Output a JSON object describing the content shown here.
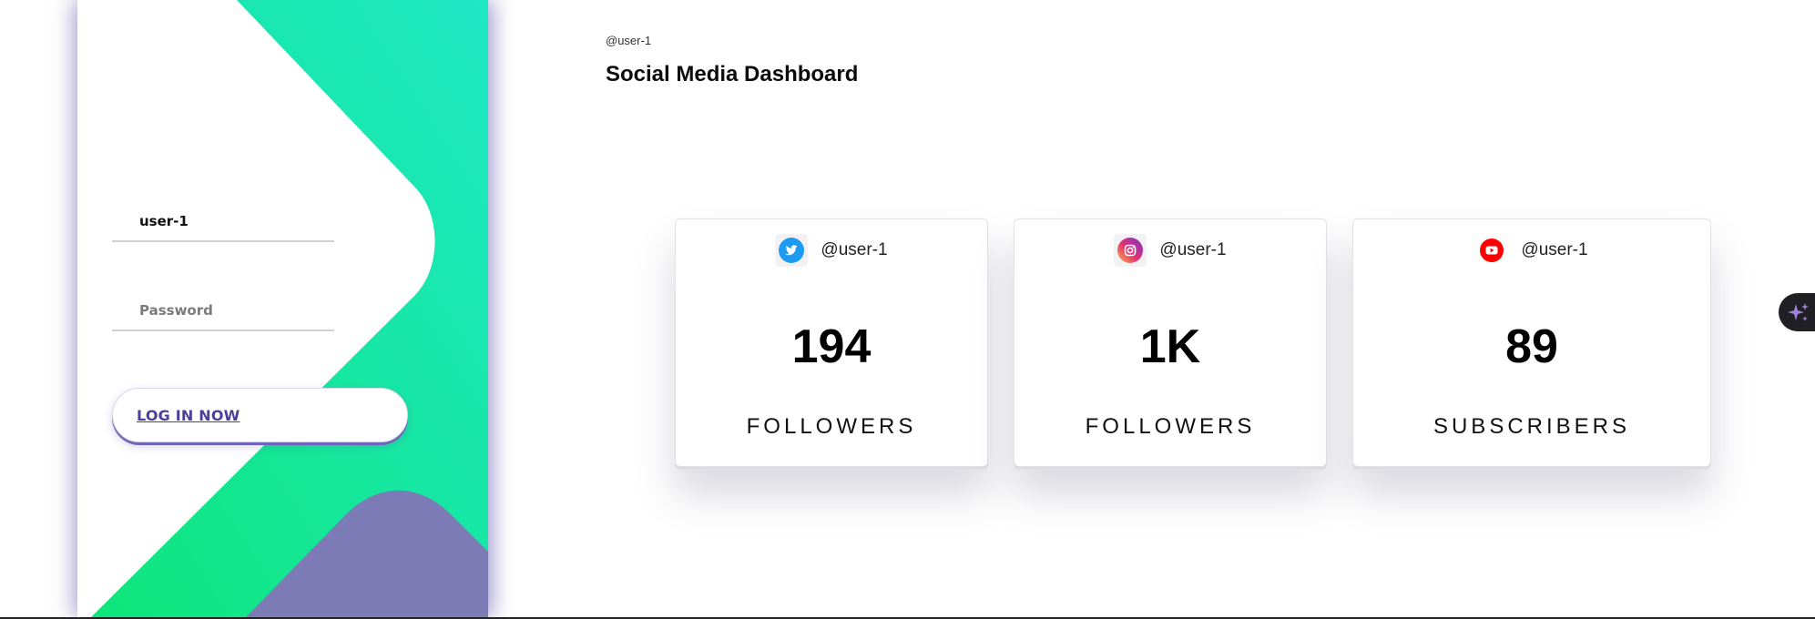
{
  "login": {
    "username_value": "user-1",
    "password_placeholder": "Password",
    "login_button_label": "LOG IN NOW"
  },
  "header": {
    "user_handle": "@user-1",
    "title": "Social Media Dashboard"
  },
  "cards": [
    {
      "platform_icon": "twitter-icon",
      "handle": "@user-1",
      "count": "194",
      "label": "FOLLOWERS",
      "accent": "#1d9bf0"
    },
    {
      "platform_icon": "instagram-icon",
      "handle": "@user-1",
      "count": "1K",
      "label": "FOLLOWERS",
      "accent": "#d6249f"
    },
    {
      "platform_icon": "youtube-icon",
      "handle": "@user-1",
      "count": "89",
      "label": "SUBSCRIBERS",
      "accent": "#ff0000"
    }
  ],
  "colors": {
    "panel_gradient_start": "#0ee67a",
    "panel_gradient_end": "#1ee8c6",
    "panel_purple": "#7c7bb6",
    "button_text": "#4c3f9a"
  },
  "assistant_tab": {
    "icon": "sparkle-icon"
  }
}
